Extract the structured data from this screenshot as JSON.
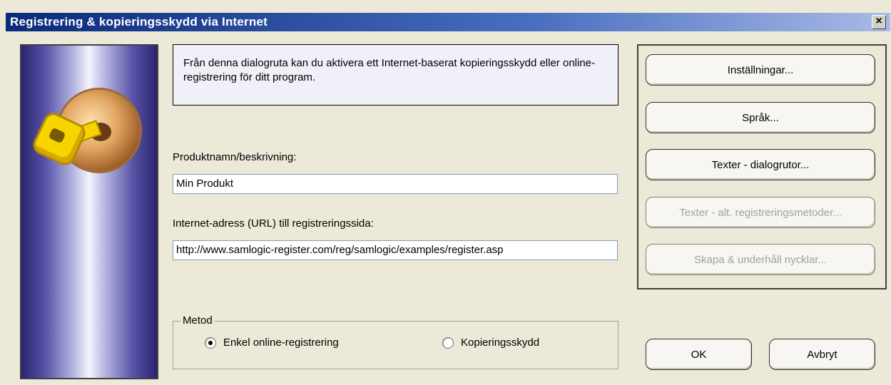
{
  "window": {
    "title": "Registrering & kopieringsskydd via Internet",
    "close_label": "×"
  },
  "info": {
    "text": "Från denna dialogruta kan du aktivera ett Internet-baserat kopieringsskydd eller online-registrering för ditt program."
  },
  "product": {
    "label": "Produktnamn/beskrivning:",
    "value": "Min Produkt"
  },
  "url": {
    "label": "Internet-adress (URL) till registreringssida:",
    "value": "http://www.samlogic-register.com/reg/samlogic/examples/register.asp"
  },
  "method": {
    "title": "Metod",
    "options": [
      {
        "label": "Enkel online-registrering",
        "selected": true
      },
      {
        "label": "Kopieringsskydd",
        "selected": false
      }
    ]
  },
  "buttons": {
    "settings": "Inställningar...",
    "language": "Språk...",
    "dialog_texts": "Texter - dialogrutor...",
    "alt_texts": "Texter - alt. registreringsmetoder...",
    "keys": "Skapa & underhåll nycklar...",
    "ok": "OK",
    "cancel": "Avbryt"
  },
  "icons": {
    "side_image": "key-disc-icon"
  }
}
